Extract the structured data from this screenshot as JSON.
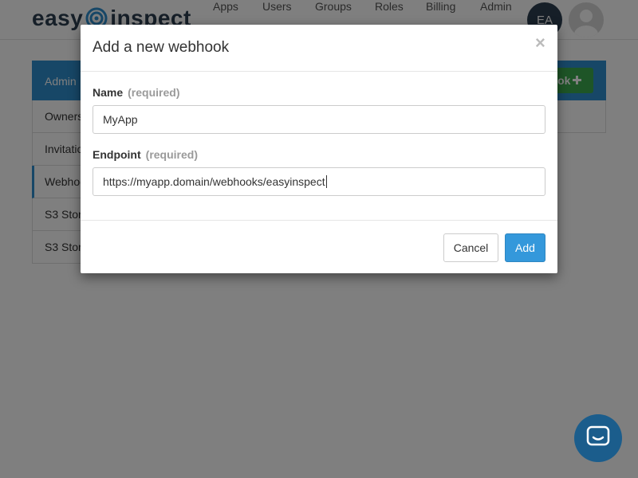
{
  "brand": {
    "left": "easy",
    "right": "inspect"
  },
  "nav": {
    "items": [
      {
        "label": "Apps"
      },
      {
        "label": "Users"
      },
      {
        "label": "Groups"
      },
      {
        "label": "Roles"
      },
      {
        "label": "Billing"
      },
      {
        "label": "Admin"
      }
    ],
    "user_initials": "EA"
  },
  "panel": {
    "title": "Admin",
    "add_button_label": "ook",
    "sidebar": [
      {
        "label": "Owners"
      },
      {
        "label": "Invitatio"
      },
      {
        "label": "Webhoo"
      },
      {
        "label": "S3 Stor"
      },
      {
        "label": "S3 Stor"
      }
    ]
  },
  "modal": {
    "title": "Add a new webhook",
    "close_symbol": "×",
    "name_label": "Name",
    "name_required": "(required)",
    "name_value": "MyApp",
    "endpoint_label": "Endpoint",
    "endpoint_required": "(required)",
    "endpoint_value": "https://myapp.domain/webhooks/easyinspect",
    "cancel_label": "Cancel",
    "add_label": "Add"
  },
  "colors": {
    "primary": "#3498db",
    "panel_header": "#2f8fcf",
    "success": "#3cab4e",
    "brand_dark": "#2c3e50",
    "chat_button": "#1b5d8c"
  },
  "icons": {
    "logo_mark": "wifi-signal-icon",
    "add": "plus-icon",
    "close": "close-icon",
    "chat": "chat-bubble-icon",
    "user": "user-silhouette-icon"
  }
}
